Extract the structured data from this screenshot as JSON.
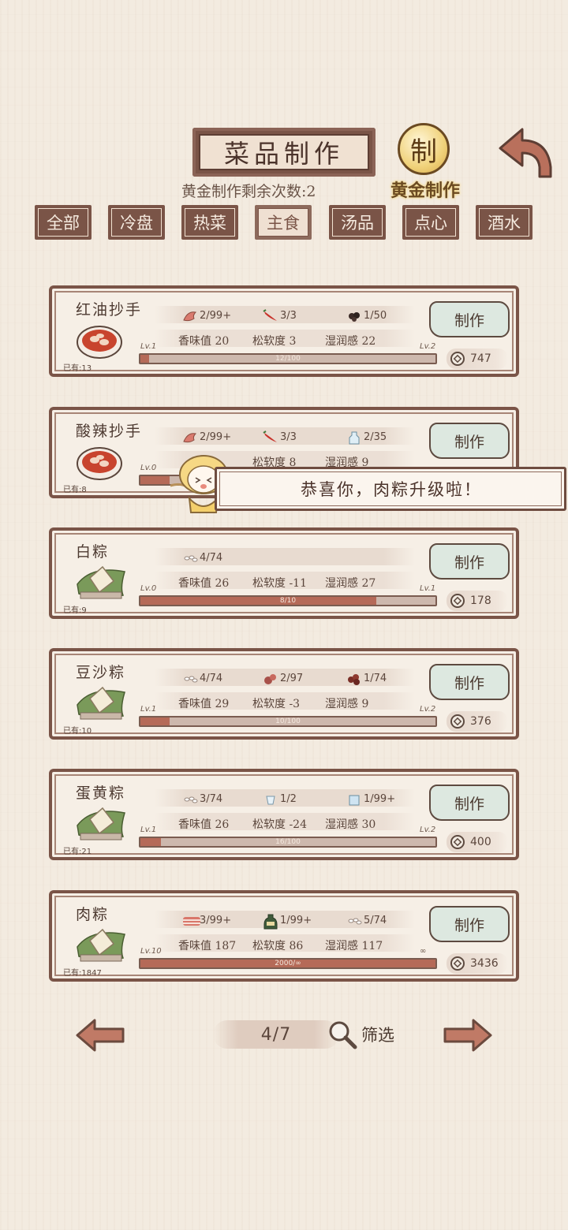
{
  "header": {
    "title": "菜品制作",
    "golden_remaining": "黄金制作剩余次数:2",
    "golden_seal_char": "制",
    "golden_label": "黄金制作"
  },
  "tabs": [
    {
      "label": "全部",
      "active": false
    },
    {
      "label": "冷盘",
      "active": false
    },
    {
      "label": "热菜",
      "active": false
    },
    {
      "label": "主食",
      "active": true
    },
    {
      "label": "汤品",
      "active": false
    },
    {
      "label": "点心",
      "active": false
    },
    {
      "label": "酒水",
      "active": false
    }
  ],
  "dishes": [
    {
      "name": "红油抄手",
      "owned": "已有:13",
      "ingredients": [
        {
          "icon": "shrimp-icon",
          "text": "2/99+"
        },
        {
          "icon": "chili-icon",
          "text": "3/3"
        },
        {
          "icon": "peppercorn-icon",
          "text": "1/50"
        }
      ],
      "stats": [
        "香味值 20",
        "松软度 3",
        "湿润感 22"
      ],
      "level": "Lv.1",
      "next_level": "Lv.2",
      "progress_text": "12/100",
      "progress": 0.03,
      "make_label": "制作",
      "price": "747"
    },
    {
      "name": "酸辣抄手",
      "owned": "已有:8",
      "ingredients": [
        {
          "icon": "shrimp-icon",
          "text": "2/99+"
        },
        {
          "icon": "chili-icon",
          "text": "3/3"
        },
        {
          "icon": "vinegar-icon",
          "text": "2/35"
        }
      ],
      "stats": [
        "",
        "松软度 8",
        "湿润感 9"
      ],
      "level": "Lv.0",
      "next_level": "",
      "progress_text": "",
      "progress": 0.1,
      "make_label": "制作",
      "price": ""
    },
    {
      "name": "白粽",
      "owned": "已有:9",
      "ingredients": [
        {
          "icon": "rice-icon",
          "text": "4/74"
        }
      ],
      "stats": [
        "香味值 26",
        "松软度 -11",
        "湿润感 27"
      ],
      "level": "Lv.0",
      "next_level": "Lv.1",
      "progress_text": "8/10",
      "progress": 0.8,
      "make_label": "制作",
      "price": "178"
    },
    {
      "name": "豆沙粽",
      "owned": "已有:10",
      "ingredients": [
        {
          "icon": "rice-icon",
          "text": "4/74"
        },
        {
          "icon": "bean-paste-icon",
          "text": "2/97"
        },
        {
          "icon": "red-bean-icon",
          "text": "1/74"
        }
      ],
      "stats": [
        "香味值 29",
        "松软度 -3",
        "湿润感 9"
      ],
      "level": "Lv.1",
      "next_level": "Lv.2",
      "progress_text": "10/100",
      "progress": 0.1,
      "make_label": "制作",
      "price": "376"
    },
    {
      "name": "蛋黄粽",
      "owned": "已有:21",
      "ingredients": [
        {
          "icon": "rice-icon",
          "text": "3/74"
        },
        {
          "icon": "salt-icon",
          "text": "1/2"
        },
        {
          "icon": "water-icon",
          "text": "1/99+"
        }
      ],
      "stats": [
        "香味值 26",
        "松软度 -24",
        "湿润感 30"
      ],
      "level": "Lv.1",
      "next_level": "Lv.2",
      "progress_text": "16/100",
      "progress": 0.07,
      "make_label": "制作",
      "price": "400"
    },
    {
      "name": "肉粽",
      "owned": "已有:1847",
      "ingredients": [
        {
          "icon": "pork-icon",
          "text": "3/99+"
        },
        {
          "icon": "soy-sauce-icon",
          "text": "1/99+"
        },
        {
          "icon": "rice-icon",
          "text": "5/74"
        }
      ],
      "stats": [
        "香味值 187",
        "松软度 86",
        "湿润感 117"
      ],
      "level": "Lv.10",
      "next_level": "∞",
      "progress_text": "2000/∞",
      "progress": 1.0,
      "make_label": "制作",
      "price": "3436"
    }
  ],
  "banner": {
    "text": "恭喜你，肉粽升级啦！"
  },
  "pager": {
    "text": "4/7",
    "filter_label": "筛选"
  }
}
